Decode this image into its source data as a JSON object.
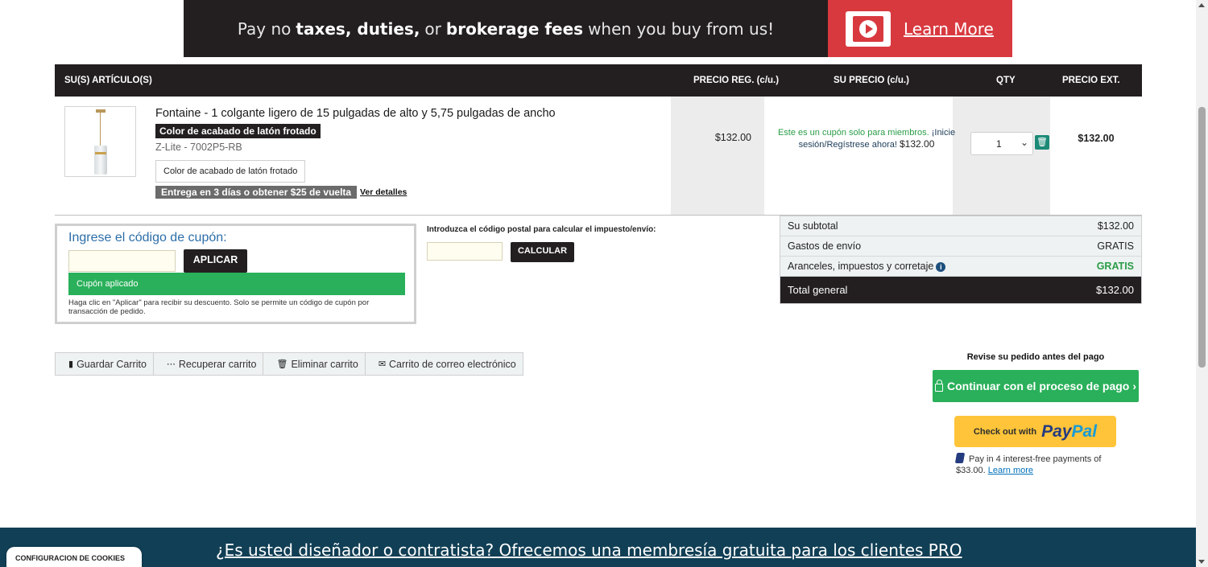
{
  "banner": {
    "text_a": "Pay no",
    "text_b": "taxes, duties,",
    "text_c": "or",
    "text_d": "brokerage fees",
    "text_e": "when you buy from us!",
    "cta": "Learn More"
  },
  "table": {
    "headers": [
      "SU(S) ARTÍCULO(S)",
      "PRECIO REG. (c/u.)",
      "SU PRECIO (c/u.)",
      "QTY",
      "PRECIO EXT."
    ]
  },
  "item": {
    "name": "Fontaine - 1 colgante ligero de 15 pulgadas de alto y 5,75 pulgadas de ancho",
    "finish_chip": "Color de acabado de latón frotado",
    "sku": "Z-Lite - 7002P5-RB",
    "option": "Color de acabado de latón frotado",
    "delivery": "Entrega en 3 días o obtener $25 de vuelta",
    "details_link": "Ver detalles",
    "reg_price": "$132.00",
    "member_note": "Este es un cupón solo para miembros.",
    "login_link": "¡Inicie sesión/Regístrese ahora!",
    "member_price": "$132.00",
    "qty": "1",
    "ext_price": "$132.00"
  },
  "coupon": {
    "title": "Ingrese el código de cupón:",
    "input_value": "",
    "button": "APLICAR",
    "applied": "Cupón aplicado",
    "note": "Haga clic en \"Aplicar\" para recibir su descuento. Solo se permite un código de cupón por transacción de pedido."
  },
  "zip": {
    "label": "Introduzca el código postal para calcular el impuesto/envío:",
    "input_value": "",
    "button": "CALCULAR"
  },
  "summary": {
    "rows": [
      {
        "label": "Su subtotal",
        "value": "$132.00"
      },
      {
        "label": "Gastos de envío",
        "value": "GRATIS"
      },
      {
        "label": "Aranceles, impuestos y corretaje",
        "value": "GRATIS"
      }
    ],
    "total_label": "Total general",
    "total_value": "$132.00"
  },
  "actions": {
    "save": "Guardar Carrito",
    "recover": "Recuperar carrito",
    "delete": "Eliminar carrito",
    "email": "Carrito de correo electrónico"
  },
  "checkout": {
    "review": "Revise su pedido antes del pago",
    "button": "Continuar con el proceso de pago",
    "paypal_prefix": "Check out with",
    "paypal_a": "Pay",
    "paypal_b": "Pal",
    "pay_in_4": "Pay in 4 interest-free payments of $33.00.",
    "learn_more": "Learn more"
  },
  "footer": {
    "text": "¿Es usted diseñador o contratista? Ofrecemos una membresía gratuita para los clientes PRO",
    "cookies": "CONFIGURACION DE COOKIES"
  },
  "colors": {
    "accent_green": "#2ab05a",
    "banner_red": "#d8393f",
    "dark": "#231f20",
    "footer_blue": "#113f55",
    "link_blue": "#2c6ea8"
  },
  "icons": [
    "video-play-icon",
    "trash-icon",
    "info-icon",
    "bookmark-icon",
    "spinner-icon",
    "trash-icon",
    "envelope-icon",
    "lock-icon",
    "chevron-right-icon",
    "chevron-down-icon",
    "paypal-icon"
  ]
}
